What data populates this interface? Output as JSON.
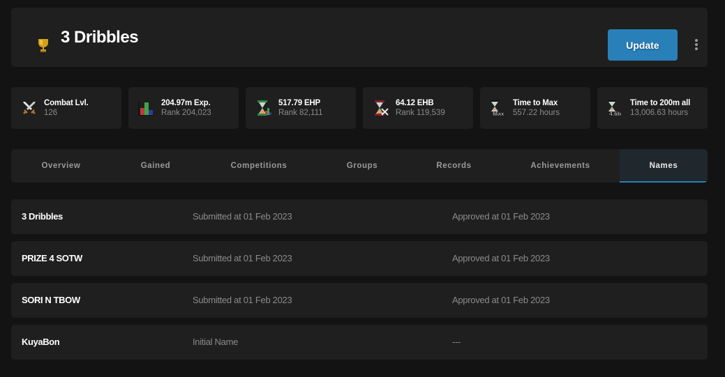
{
  "header": {
    "title": "3 Dribbles",
    "trophy_icon": "trophy-icon",
    "update_label": "Update",
    "menu_icon": "more-vertical-icon",
    "accent_color": "#2980b9"
  },
  "stats": [
    {
      "icon": "crossed-swords-icon",
      "label": "Combat Lvl.",
      "value": "126"
    },
    {
      "icon": "bar-chart-icon",
      "label": "204.97m Exp.",
      "value": "Rank 204,023"
    },
    {
      "icon": "hourglass-skills-icon",
      "label": "517.79 EHP",
      "value": "Rank 82,111"
    },
    {
      "icon": "hourglass-combat-icon",
      "label": "64.12 EHB",
      "value": "Rank 119,539"
    },
    {
      "icon": "hourglass-max-icon",
      "label": "Time to Max",
      "value": "557.22 hours",
      "badge": "Max"
    },
    {
      "icon": "hourglass-200m-icon",
      "label": "Time to 200m all",
      "value": "13,006.63 hours",
      "badge": "4.6b"
    }
  ],
  "tabs": [
    {
      "label": "Overview",
      "active": false
    },
    {
      "label": "Gained",
      "active": false
    },
    {
      "label": "Competitions",
      "active": false
    },
    {
      "label": "Groups",
      "active": false
    },
    {
      "label": "Records",
      "active": false
    },
    {
      "label": "Achievements",
      "active": false
    },
    {
      "label": "Names",
      "active": true
    }
  ],
  "names": [
    {
      "name": "3 Dribbles",
      "submitted": "Submitted at 01 Feb 2023",
      "approved": "Approved at 01 Feb 2023"
    },
    {
      "name": "PRIZE 4 SOTW",
      "submitted": "Submitted at 01 Feb 2023",
      "approved": "Approved at 01 Feb 2023"
    },
    {
      "name": "SORI N TBOW",
      "submitted": "Submitted at 01 Feb 2023",
      "approved": "Approved at 01 Feb 2023"
    },
    {
      "name": "KuyaBon",
      "submitted": "Initial Name",
      "approved": "---"
    }
  ]
}
